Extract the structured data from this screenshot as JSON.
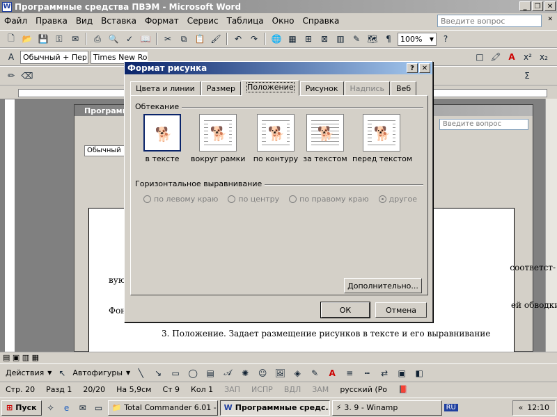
{
  "window": {
    "title": "Программные средства ПВЭМ - Microsoft Word",
    "app_letter": "W"
  },
  "menu": {
    "items": [
      "Файл",
      "Правка",
      "Вид",
      "Вставка",
      "Формат",
      "Сервис",
      "Таблица",
      "Окно",
      "Справка"
    ],
    "help_placeholder": "Введите вопрос"
  },
  "toolbar": {
    "zoom": "100%",
    "style": "Обычный + Пер",
    "font": "Times New Roma"
  },
  "inner_window": {
    "title": "Программные",
    "help_placeholder": "Введите вопрос",
    "style": "Обычный"
  },
  "page": {
    "line1": "вую",
    "line1_right": "соответст-",
    "line2": "Фон",
    "line2_right": "ей обводки.",
    "line3": "3. Положение. Задает размещение рисунков в тексте и его выравнивание"
  },
  "dialog": {
    "title": "Формат рисунка",
    "tabs": [
      {
        "label": "Цвета и линии"
      },
      {
        "label": "Размер"
      },
      {
        "label": "Положение"
      },
      {
        "label": "Рисунок"
      },
      {
        "label": "Надпись"
      },
      {
        "label": "Веб"
      }
    ],
    "wrap_group": "Обтекание",
    "wrap_options": [
      "в тексте",
      "вокруг рамки",
      "по контуру",
      "за текстом",
      "перед текстом"
    ],
    "align_group": "Горизонтальное выравнивание",
    "align_options": [
      "по левому краю",
      "по центру",
      "по правому краю",
      "другое"
    ],
    "advanced_button": "Дополнительно...",
    "ok_button": "ОК",
    "cancel_button": "Отмена"
  },
  "drawbar": {
    "actions": "Действия",
    "autoshapes": "Автофигуры"
  },
  "status": {
    "page": "Стр. 20",
    "section": "Разд 1",
    "pages": "20/20",
    "at": "На 5,9см",
    "line": "Ст 9",
    "col": "Кол 1",
    "rec": "ЗАП",
    "trk": "ИСПР",
    "ext": "ВДЛ",
    "ovr": "ЗАМ",
    "language": "русский (Ро"
  },
  "taskbar": {
    "start": "Пуск",
    "tasks": [
      "Total Commander 6.01 - ...",
      "Программные средс...",
      "3. 9 - Winamp"
    ],
    "lang": "RU",
    "time": "12:10"
  }
}
